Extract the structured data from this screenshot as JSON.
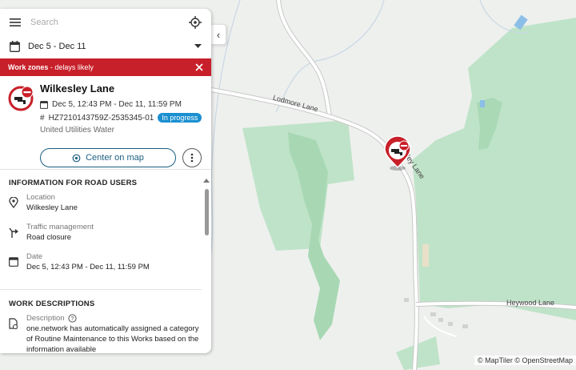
{
  "search": {
    "placeholder": "Search"
  },
  "date_filter": {
    "value": "Dec 5 - Dec 11"
  },
  "banner": {
    "label_bold": "Work zones",
    "label_rest": " - delays likely"
  },
  "work": {
    "title": "Wilkesley Lane",
    "date_range": "Dec 5, 12:43 PM - Dec 11, 11:59 PM",
    "reference_symbol": "#",
    "reference": "HZ7210143759Z-2535345-01",
    "status": "In progress",
    "organisation": "United Utilities Water",
    "center_button": "Center on map"
  },
  "info_section": {
    "title": "INFORMATION FOR ROAD USERS",
    "items": [
      {
        "label": "Location",
        "value": "Wilkesley Lane",
        "icon": "location-pin-icon"
      },
      {
        "label": "Traffic management",
        "value": "Road closure",
        "icon": "turn-arrow-icon"
      },
      {
        "label": "Date",
        "value": "Dec 5, 12:43 PM - Dec 11, 11:59 PM",
        "icon": "calendar-icon"
      }
    ]
  },
  "desc_section": {
    "title": "WORK DESCRIPTIONS",
    "label": "Description",
    "text": "one.network has automatically assigned a category of Routine Maintenance to this Works based on the information available"
  },
  "map": {
    "road_labels": {
      "lodmore": "Lodmore Lane",
      "wilkesley": "Wilkesley Lane",
      "heywood": "Heywood Lane"
    },
    "attribution": "© MapTiler © OpenStreetMap",
    "colors": {
      "background": "#eef0ee",
      "woodland": "#b9dfc3",
      "dark_wood": "#8fcf9e",
      "water": "#7fb6e6",
      "road": "#ffffff",
      "alert_red": "#c8202a"
    }
  }
}
